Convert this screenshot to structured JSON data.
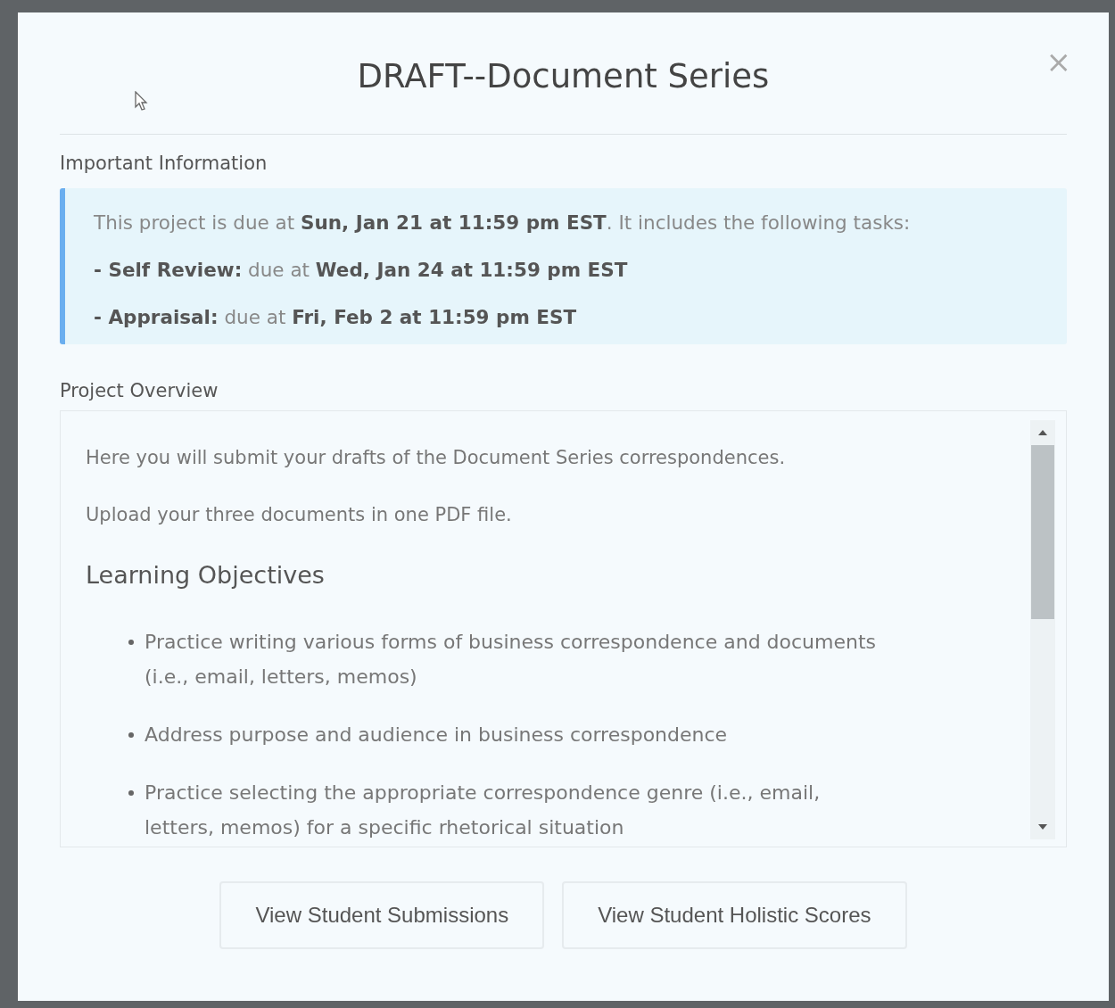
{
  "dialog": {
    "title": "DRAFT--Document Series",
    "close": "×"
  },
  "important_information": {
    "heading": "Important Information",
    "lines": [
      "This project is due at **Sun, Jan 21 at 11:59 pm EST**. It includes the following tasks:",
      "**- Self Review:** due at **Wed, Jan 24 at 11:59 pm EST**",
      "**- Appraisal:** due at **Fri, Feb 2 at 11:59 pm EST**"
    ]
  },
  "project_overview": {
    "heading": "Project Overview",
    "paragraphs": [
      "Here you will submit your drafts of the Document Series correspondences.",
      "Upload your three documents in one PDF file."
    ],
    "section_heading": "Learning Objectives",
    "objectives": [
      "Practice writing various forms of business correspondence and documents (i.e., email, letters, memos)",
      "Address purpose and audience in business correspondence",
      "Practice selecting the appropriate correspondence genre (i.e., email, letters, memos) for a specific rhetorical situation"
    ]
  },
  "buttons": [
    "View Student Submissions",
    "View Student Holistic Scores"
  ]
}
